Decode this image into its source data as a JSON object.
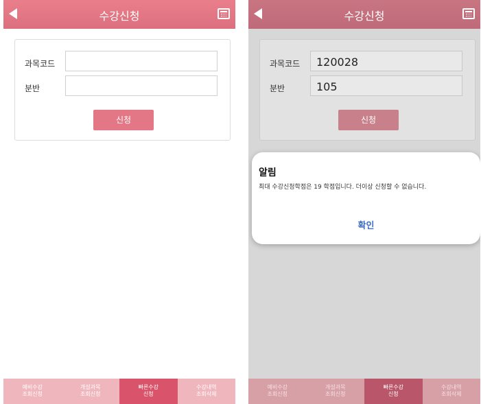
{
  "screens": [
    {
      "header": {
        "title": "수강신청"
      },
      "form": {
        "code_label": "과목코드",
        "code_value": "",
        "section_label": "분반",
        "section_value": "",
        "apply_label": "신청"
      },
      "tabs": [
        {
          "line1": "예비수강",
          "line2": "조회신청"
        },
        {
          "line1": "개설과목",
          "line2": "조회신청"
        },
        {
          "line1": "빠른수강",
          "line2": "신청"
        },
        {
          "line1": "수강내역",
          "line2": "조회삭제"
        }
      ]
    },
    {
      "header": {
        "title": "수강신청"
      },
      "form": {
        "code_label": "과목코드",
        "code_value": "120028",
        "section_label": "분반",
        "section_value": "105",
        "apply_label": "신청"
      },
      "tabs": [
        {
          "line1": "예비수강",
          "line2": "조회신청"
        },
        {
          "line1": "개설과목",
          "line2": "조회신청"
        },
        {
          "line1": "빠른수강",
          "line2": "신청"
        },
        {
          "line1": "수강내역",
          "line2": "조회삭제"
        }
      ],
      "dialog": {
        "title": "알림",
        "message": "최대 수강신청학점은 19 학점입니다. 더이상 신청할 수 없습니다.",
        "ok_label": "확인"
      }
    }
  ],
  "colors": {
    "header": "#e57a87",
    "accent_button": "#e47785",
    "tab_active": "#d9546a",
    "dialog_ok": "#3e6fc1"
  }
}
